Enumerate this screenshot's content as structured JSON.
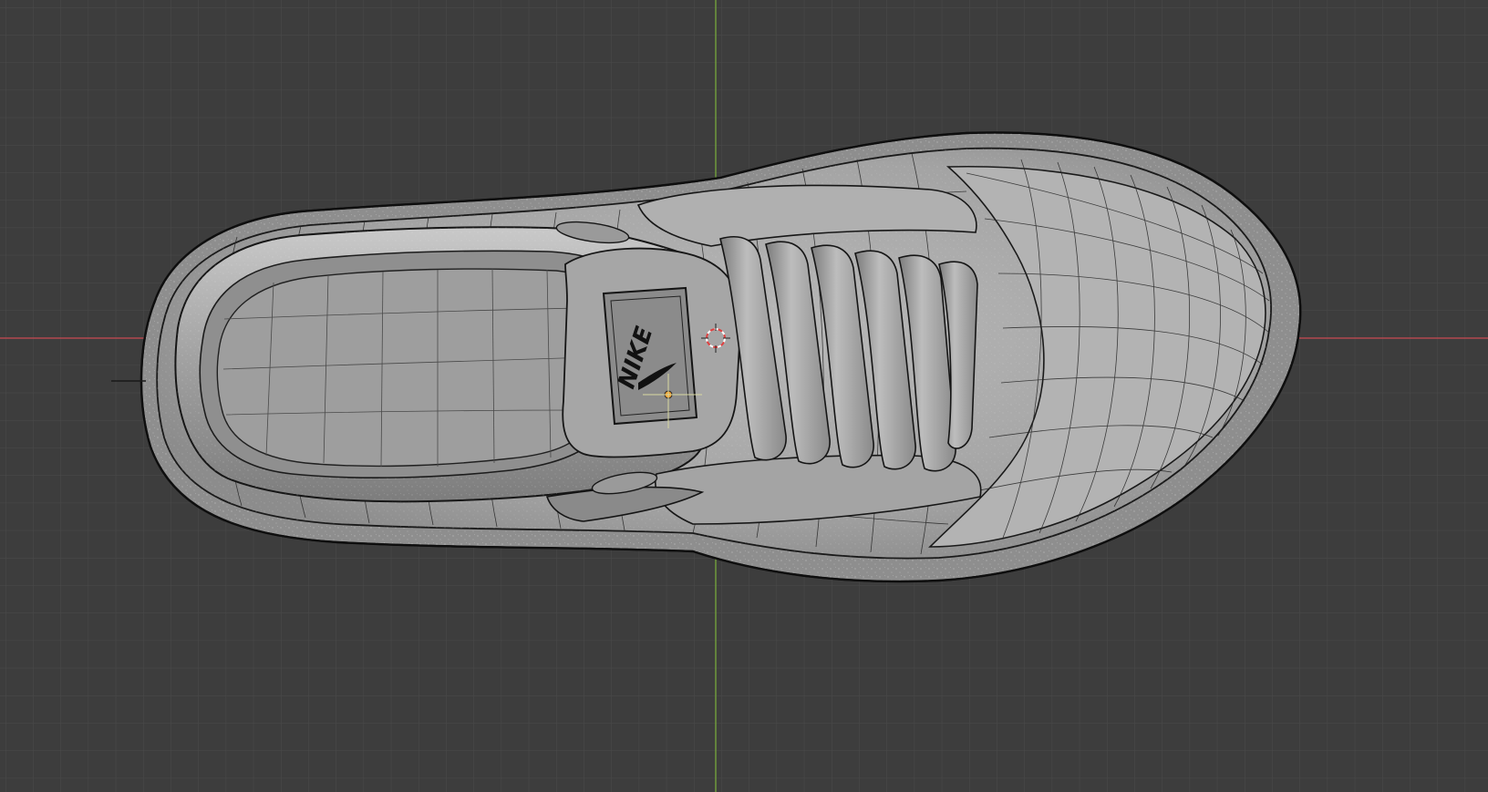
{
  "viewport": {
    "mode": "top-orthographic",
    "shading": "solid-with-wireframe-overlay",
    "grid": true,
    "axes": {
      "x_color": "#c84a52",
      "y_color": "#7bb03c"
    },
    "background_color": "#3d3d3d"
  },
  "object": {
    "name": "sneaker-mesh",
    "surface_color": "#a9a9a9",
    "wire_color": "#1a1a1a",
    "tongue_label_lettering": "NIKE"
  },
  "gizmos": {
    "origin_marker": "origin-point-icon",
    "cursor_3d": "3d-cursor-icon"
  }
}
